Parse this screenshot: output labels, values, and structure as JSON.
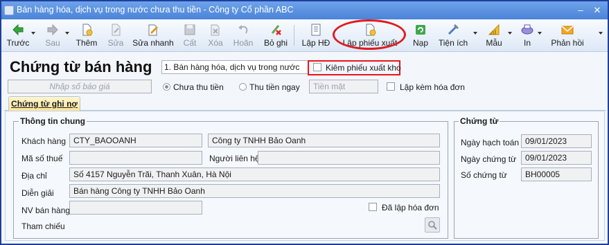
{
  "window": {
    "title": "Bán hàng hóa, dịch vụ trong nước chưa thu tiền - Công ty Cổ phần ABC",
    "minimize": "–",
    "close": "✕"
  },
  "toolbar": {
    "prev": "Trước",
    "next": "Sau",
    "add": "Thêm",
    "edit": "Sửa",
    "quick_edit": "Sửa nhanh",
    "save": "Cất",
    "delete": "Xóa",
    "undo": "Hoãn",
    "unpost": "Bỏ ghi",
    "create_invoice": "Lập HĐ",
    "create_issue_note": "Lập phiếu xuất",
    "reload": "Nạp",
    "utilities": "Tiện ích",
    "template": "Mẫu",
    "print": "In",
    "feedback": "Phản hồi"
  },
  "header": {
    "title": "Chứng từ bán hàng",
    "sale_type": "1. Bán hàng hóa, dịch vụ trong nước",
    "issue_note_checkbox": "Kiêm phiếu xuất kho",
    "quote_placeholder": "Nhập số báo giá",
    "payment_unpaid": "Chưa thu tiền",
    "payment_paid": "Thu tiền ngay",
    "payment_method": "Tiền mặt",
    "with_invoice": "Lập kèm hóa đơn"
  },
  "tabs": [
    {
      "label": "Chứng từ ghi nợ"
    }
  ],
  "general": {
    "section_title": "Thông tin chung",
    "customer_label": "Khách hàng",
    "customer_code": "CTY_BAOOANH",
    "customer_name": "Công ty TNHH Bảo Oanh",
    "tax_label": "Mã số thuế",
    "tax_value": "",
    "contact_label": "Người liên hệ",
    "contact_value": "",
    "address_label": "Địa chỉ",
    "address_value": "Số 4157 Nguyễn Trãi, Thanh Xuân, Hà Nội",
    "description_label": "Diễn giải",
    "description_value": "Bán hàng Công ty TNHH Bảo Oanh",
    "salesperson_label": "NV bán hàng",
    "salesperson_value": "",
    "invoiced_label": "Đã lập hóa đơn",
    "reference_label": "Tham chiếu"
  },
  "voucher": {
    "section_title": "Chứng từ",
    "posting_date_label": "Ngày hạch toán",
    "posting_date": "09/01/2023",
    "voucher_date_label": "Ngày chứng từ",
    "voucher_date": "09/01/2023",
    "voucher_no_label": "Số chứng từ",
    "voucher_no": "BH00005"
  },
  "colors": {
    "titlebar": "#4a83d8",
    "highlight": "#e8151b",
    "tab": "#fbe39a"
  }
}
